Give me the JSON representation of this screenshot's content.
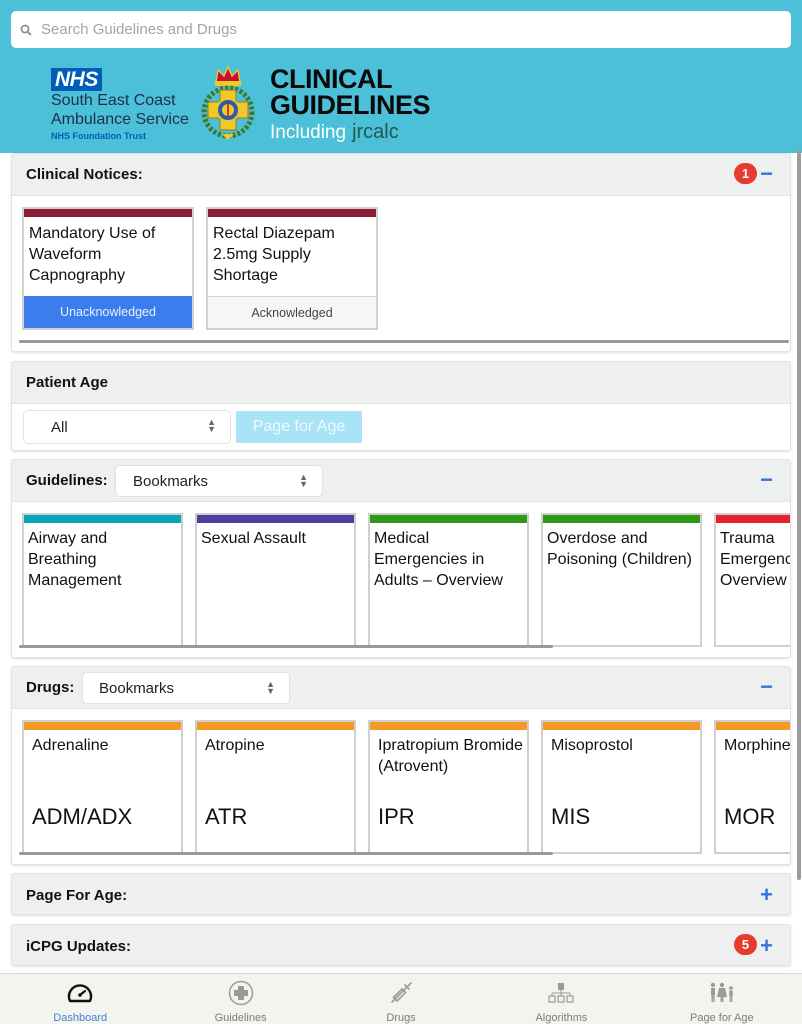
{
  "search": {
    "placeholder": "Search Guidelines and Drugs",
    "value": ""
  },
  "branding": {
    "nhs_mark": "NHS",
    "org_line1": "South East Coast",
    "org_line2": "Ambulance Service",
    "trust_line": "NHS Foundation Trust",
    "title_line1": "CLINICAL",
    "title_line2": "GUIDELINES",
    "including": "Including",
    "jrcalc": "jrcalc"
  },
  "clinical_notices": {
    "title": "Clinical Notices:",
    "badge": "1",
    "toggle": "−",
    "items": [
      {
        "title": "Mandatory Use of Waveform Capnography",
        "status": "Unacknowledged"
      },
      {
        "title": "Rectal Diazepam 2.5mg Supply Shortage",
        "status": "Acknowledged"
      }
    ]
  },
  "patient_age": {
    "title": "Patient Age",
    "selected": "All",
    "button": "Page for Age"
  },
  "guidelines": {
    "title": "Guidelines:",
    "filter": "Bookmarks",
    "toggle": "−",
    "items": [
      {
        "title": "Airway and Breathing Management",
        "color": "#08a7b8"
      },
      {
        "title": "Sexual Assault",
        "color": "#4f3e9f"
      },
      {
        "title": "Medical Emergencies in Adults – Overview",
        "color": "#2c9a17"
      },
      {
        "title": "Overdose and Poisoning (Children)",
        "color": "#2c9a17"
      },
      {
        "title": "Trauma Emergencies Overview",
        "color": "#e5222b"
      }
    ]
  },
  "drugs": {
    "title": "Drugs:",
    "filter": "Bookmarks",
    "toggle": "−",
    "items": [
      {
        "name": "Adrenaline",
        "code": "ADM/ADX"
      },
      {
        "name": "Atropine",
        "code": "ATR"
      },
      {
        "name": "Ipratropium Bromide (Atrovent)",
        "code": "IPR"
      },
      {
        "name": "Misoprostol",
        "code": "MIS"
      },
      {
        "name": "Morphine",
        "code": "MOR"
      }
    ],
    "color": "#f39a26"
  },
  "page_for_age": {
    "title": "Page For Age:",
    "toggle": "+"
  },
  "icpg_updates": {
    "title": "iCPG Updates:",
    "badge": "5",
    "toggle": "+"
  },
  "tabbar": {
    "tabs": [
      {
        "label": "Dashboard",
        "icon": "speedometer-icon",
        "active": true
      },
      {
        "label": "Guidelines",
        "icon": "medical-cross-icon"
      },
      {
        "label": "Drugs",
        "icon": "syringe-icon"
      },
      {
        "label": "Algorithms",
        "icon": "flowchart-icon"
      },
      {
        "label": "Page for Age",
        "icon": "family-icon"
      }
    ]
  }
}
